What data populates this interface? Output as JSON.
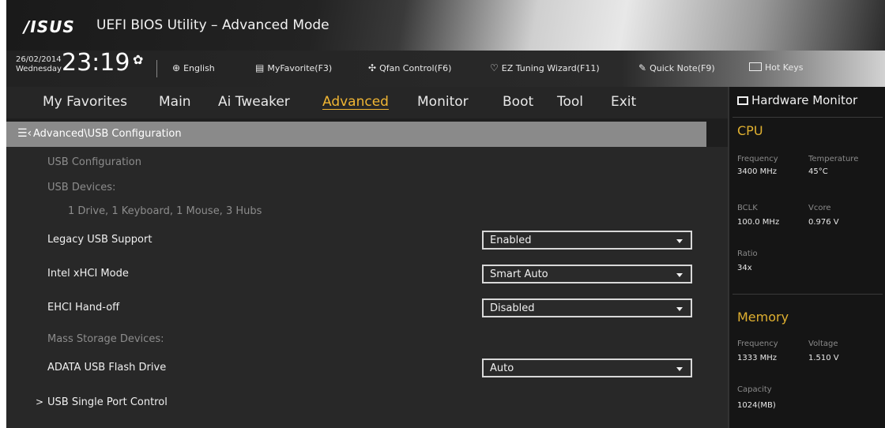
{
  "header": {
    "logo": "/ISUS",
    "title": "UEFI BIOS Utility – Advanced Mode"
  },
  "infobar": {
    "date": "26/02/2014",
    "weekday": "Wednesday",
    "time": "23:19",
    "language": "English",
    "my_favorite": "MyFavorite(F3)",
    "qfan": "Qfan Control(F6)",
    "ez_tuning": "EZ Tuning Wizard(F11)",
    "quick_note": "Quick Note(F9)",
    "hot_keys": "Hot Keys"
  },
  "nav": {
    "tabs": [
      "My Favorites",
      "Main",
      "Ai Tweaker",
      "Advanced",
      "Monitor",
      "Boot",
      "Tool",
      "Exit"
    ],
    "active": "Advanced"
  },
  "breadcrumb": "Advanced\\USB Configuration",
  "settings": {
    "usb_configuration": "USB Configuration",
    "usb_devices_label": "USB Devices:",
    "usb_devices_value": "1 Drive, 1 Keyboard, 1 Mouse, 3 Hubs",
    "legacy_usb": {
      "label": "Legacy USB Support",
      "value": "Enabled"
    },
    "xhci_mode": {
      "label": "Intel xHCI Mode",
      "value": "Smart Auto"
    },
    "ehci_handoff": {
      "label": "EHCI Hand-off",
      "value": "Disabled"
    },
    "mass_storage_label": "Mass Storage Devices:",
    "adata_drive": {
      "label": "ADATA USB Flash Drive",
      "value": "Auto"
    },
    "single_port_control": "USB Single Port Control"
  },
  "hardware_monitor": {
    "title": "Hardware Monitor",
    "cpu": {
      "heading": "CPU",
      "frequency_label": "Frequency",
      "frequency": "3400 MHz",
      "temperature_label": "Temperature",
      "temperature": "45°C",
      "bclk_label": "BCLK",
      "bclk": "100.0 MHz",
      "vcore_label": "Vcore",
      "vcore": "0.976 V",
      "ratio_label": "Ratio",
      "ratio": "34x"
    },
    "memory": {
      "heading": "Memory",
      "frequency_label": "Frequency",
      "frequency": "1333 MHz",
      "voltage_label": "Voltage",
      "voltage": "1.510 V",
      "capacity_label": "Capacity",
      "capacity": "1024(MB)"
    }
  },
  "colors": {
    "accent": "#f0b533",
    "background": "#282828",
    "breadcrumb": "#8a8a8a",
    "monitor_heading": "#e0b030"
  }
}
